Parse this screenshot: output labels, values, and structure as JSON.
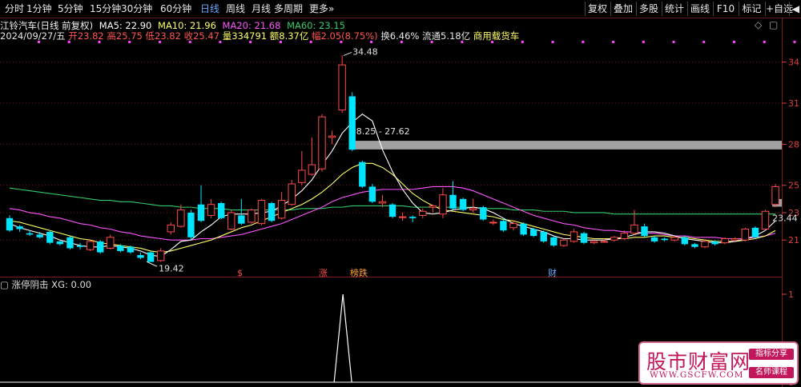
{
  "toolbar": {
    "periods": [
      "分时",
      "1分钟",
      "5分钟",
      "15分钟",
      "30分钟",
      "60分钟",
      "日线",
      "周线",
      "月线",
      "多周期",
      "更多"
    ],
    "active_period": "日线",
    "more_suffix": "»",
    "right_buttons": [
      "复权",
      "叠加",
      "多股",
      "统计",
      "画线",
      "F10",
      "标记",
      "+自选",
      "◀"
    ]
  },
  "info": {
    "stock_title": "江铃汽车(日线 前复权)",
    "ma5_label": "MA5: 22.90",
    "ma10_label": "MA10: 21.96",
    "ma20_label": "MA20: 21.68",
    "ma60_label": "MA60: 23.15",
    "date": "2024/09/27/五",
    "open": "开23.82",
    "high": "高25.75",
    "low": "低23.82",
    "close": "收25.47",
    "volume": "量334791",
    "amount": "额8.37亿",
    "change": "幅2.05(8.75%)",
    "turnover": "换6.46%",
    "float_cap": "流通5.18亿",
    "sector": "商用载货车",
    "corner_icons": [
      "◇",
      "▢"
    ]
  },
  "colors": {
    "up": "#ff4a4a",
    "down": "#00e5ff",
    "ma5": "#ffffff",
    "ma10": "#ffff66",
    "ma20": "#ff55ff",
    "ma60": "#33cc66",
    "grid": "#7a1c1c",
    "axis_text": "#e04040",
    "marker": "#ff40ff"
  },
  "chart_data": {
    "type": "candlestick",
    "ylim": [
      18.5,
      35.5
    ],
    "y_ticks": [
      21,
      23,
      25,
      28,
      31,
      34
    ],
    "candles": [
      {
        "o": 22.6,
        "c": 21.7,
        "h": 22.8,
        "l": 21.6
      },
      {
        "o": 22.0,
        "c": 21.8,
        "h": 22.1,
        "l": 21.6
      },
      {
        "o": 21.5,
        "c": 21.4,
        "h": 21.7,
        "l": 21.3
      },
      {
        "o": 21.4,
        "c": 21.2,
        "h": 21.6,
        "l": 21.1
      },
      {
        "o": 21.6,
        "c": 20.8,
        "h": 21.7,
        "l": 20.7
      },
      {
        "o": 20.9,
        "c": 20.7,
        "h": 21.0,
        "l": 20.6
      },
      {
        "o": 21.2,
        "c": 20.4,
        "h": 21.3,
        "l": 20.3
      },
      {
        "o": 20.6,
        "c": 20.5,
        "h": 20.8,
        "l": 20.3
      },
      {
        "o": 20.3,
        "c": 20.9,
        "h": 21.0,
        "l": 20.2
      },
      {
        "o": 20.9,
        "c": 20.1,
        "h": 21.0,
        "l": 20.0
      },
      {
        "o": 20.4,
        "c": 21.2,
        "h": 21.4,
        "l": 20.3
      },
      {
        "o": 20.6,
        "c": 20.2,
        "h": 20.7,
        "l": 20.1
      },
      {
        "o": 20.5,
        "c": 20.1,
        "h": 20.6,
        "l": 20.0
      },
      {
        "o": 19.9,
        "c": 19.7,
        "h": 20.1,
        "l": 19.6
      },
      {
        "o": 20.1,
        "c": 19.4,
        "h": 20.2,
        "l": 19.4
      },
      {
        "o": 19.5,
        "c": 20.2,
        "h": 20.4,
        "l": 19.4
      },
      {
        "o": 21.6,
        "c": 22.1,
        "h": 22.3,
        "l": 21.4
      },
      {
        "o": 22.0,
        "c": 23.2,
        "h": 23.6,
        "l": 21.9
      },
      {
        "o": 23.0,
        "c": 21.2,
        "h": 23.2,
        "l": 21.0
      },
      {
        "o": 23.6,
        "c": 22.4,
        "h": 25.0,
        "l": 22.3
      },
      {
        "o": 22.8,
        "c": 23.6,
        "h": 24.0,
        "l": 22.6
      },
      {
        "o": 23.7,
        "c": 22.6,
        "h": 23.8,
        "l": 22.5
      },
      {
        "o": 21.8,
        "c": 23.0,
        "h": 23.2,
        "l": 21.7
      },
      {
        "o": 22.8,
        "c": 22.2,
        "h": 24.0,
        "l": 22.1
      },
      {
        "o": 22.3,
        "c": 23.2,
        "h": 23.3,
        "l": 22.2
      },
      {
        "o": 22.2,
        "c": 23.9,
        "h": 24.0,
        "l": 22.1
      },
      {
        "o": 23.7,
        "c": 22.4,
        "h": 23.8,
        "l": 22.3
      },
      {
        "o": 22.6,
        "c": 23.9,
        "h": 24.5,
        "l": 22.5
      },
      {
        "o": 23.6,
        "c": 25.1,
        "h": 25.4,
        "l": 23.5
      },
      {
        "o": 25.2,
        "c": 26.1,
        "h": 27.5,
        "l": 25.0
      },
      {
        "o": 25.8,
        "c": 26.5,
        "h": 28.5,
        "l": 25.7
      },
      {
        "o": 26.2,
        "c": 30.0,
        "h": 30.2,
        "l": 26.0
      },
      {
        "o": 28.5,
        "c": 28.6,
        "h": 29.0,
        "l": 28.0
      },
      {
        "o": 30.5,
        "c": 33.8,
        "h": 34.5,
        "l": 30.3
      },
      {
        "o": 31.5,
        "c": 27.6,
        "h": 31.8,
        "l": 27.5
      },
      {
        "o": 26.7,
        "c": 24.9,
        "h": 26.8,
        "l": 24.8
      },
      {
        "o": 24.9,
        "c": 23.8,
        "h": 25.1,
        "l": 23.7
      },
      {
        "o": 23.7,
        "c": 23.8,
        "h": 24.3,
        "l": 23.4
      },
      {
        "o": 23.6,
        "c": 22.7,
        "h": 23.7,
        "l": 22.6
      },
      {
        "o": 22.7,
        "c": 22.7,
        "h": 23.0,
        "l": 22.4
      },
      {
        "o": 22.7,
        "c": 22.6,
        "h": 22.8,
        "l": 22.3
      },
      {
        "o": 22.8,
        "c": 23.1,
        "h": 23.3,
        "l": 22.6
      },
      {
        "o": 23.4,
        "c": 23.5,
        "h": 23.6,
        "l": 23.0
      },
      {
        "o": 22.9,
        "c": 24.3,
        "h": 24.8,
        "l": 22.6
      },
      {
        "o": 24.3,
        "c": 23.3,
        "h": 25.3,
        "l": 23.2
      },
      {
        "o": 24.0,
        "c": 23.2,
        "h": 24.1,
        "l": 23.1
      },
      {
        "o": 23.2,
        "c": 23.3,
        "h": 24.0,
        "l": 23.0
      },
      {
        "o": 23.4,
        "c": 22.5,
        "h": 23.5,
        "l": 22.4
      },
      {
        "o": 22.3,
        "c": 22.3,
        "h": 22.5,
        "l": 22.1
      },
      {
        "o": 22.4,
        "c": 21.7,
        "h": 22.6,
        "l": 21.6
      },
      {
        "o": 21.9,
        "c": 22.2,
        "h": 22.4,
        "l": 21.7
      },
      {
        "o": 22.2,
        "c": 21.4,
        "h": 22.3,
        "l": 21.3
      },
      {
        "o": 21.8,
        "c": 21.3,
        "h": 21.9,
        "l": 21.2
      },
      {
        "o": 21.6,
        "c": 20.9,
        "h": 21.7,
        "l": 20.8
      },
      {
        "o": 21.2,
        "c": 20.6,
        "h": 21.3,
        "l": 20.5
      },
      {
        "o": 20.6,
        "c": 21.0,
        "h": 21.1,
        "l": 20.5
      },
      {
        "o": 20.9,
        "c": 21.6,
        "h": 21.8,
        "l": 20.8
      },
      {
        "o": 21.5,
        "c": 20.8,
        "h": 21.6,
        "l": 20.7
      },
      {
        "o": 20.8,
        "c": 20.9,
        "h": 21.0,
        "l": 20.7
      },
      {
        "o": 20.9,
        "c": 20.9,
        "h": 21.1,
        "l": 20.8
      },
      {
        "o": 21.0,
        "c": 21.2,
        "h": 21.3,
        "l": 20.9
      },
      {
        "o": 21.1,
        "c": 21.5,
        "h": 21.7,
        "l": 21.0
      },
      {
        "o": 21.5,
        "c": 22.1,
        "h": 23.2,
        "l": 21.4
      },
      {
        "o": 22.0,
        "c": 21.3,
        "h": 22.2,
        "l": 21.2
      },
      {
        "o": 21.2,
        "c": 20.9,
        "h": 21.3,
        "l": 20.8
      },
      {
        "o": 21.1,
        "c": 21.0,
        "h": 21.2,
        "l": 20.9
      },
      {
        "o": 21.0,
        "c": 21.2,
        "h": 21.3,
        "l": 20.9
      },
      {
        "o": 21.2,
        "c": 20.7,
        "h": 21.3,
        "l": 20.6
      },
      {
        "o": 20.7,
        "c": 20.5,
        "h": 20.8,
        "l": 20.4
      },
      {
        "o": 20.5,
        "c": 20.9,
        "h": 21.0,
        "l": 20.4
      },
      {
        "o": 20.9,
        "c": 20.7,
        "h": 21.0,
        "l": 20.6
      },
      {
        "o": 20.8,
        "c": 21.1,
        "h": 21.2,
        "l": 20.7
      },
      {
        "o": 21.0,
        "c": 21.1,
        "h": 21.2,
        "l": 20.9
      },
      {
        "o": 21.0,
        "c": 21.8,
        "h": 21.9,
        "l": 20.9
      },
      {
        "o": 21.9,
        "c": 21.2,
        "h": 22.0,
        "l": 21.1
      },
      {
        "o": 21.8,
        "c": 23.1,
        "h": 23.2,
        "l": 21.7
      },
      {
        "o": 23.6,
        "c": 24.9,
        "h": 25.1,
        "l": 23.4
      }
    ],
    "ma5": [
      22.2,
      21.9,
      21.7,
      21.5,
      21.3,
      21.0,
      20.8,
      20.6,
      20.5,
      20.5,
      20.6,
      20.5,
      20.4,
      20.2,
      19.9,
      19.8,
      20.3,
      20.9,
      21.0,
      21.6,
      22.1,
      22.7,
      22.9,
      22.9,
      22.9,
      23.0,
      23.1,
      23.5,
      24.0,
      24.6,
      25.4,
      26.5,
      27.5,
      28.8,
      29.6,
      30.2,
      29.7,
      27.6,
      26.0,
      24.7,
      23.7,
      23.0,
      22.9,
      23.0,
      23.2,
      23.3,
      23.4,
      23.3,
      23.0,
      22.6,
      22.2,
      22.0,
      21.8,
      21.6,
      21.3,
      21.1,
      21.1,
      21.0,
      21.0,
      21.0,
      21.1,
      21.2,
      21.4,
      21.6,
      21.6,
      21.5,
      21.3,
      21.1,
      21.0,
      20.9,
      20.8,
      20.8,
      20.9,
      21.1,
      21.3,
      21.7,
      22.4
    ],
    "ma10": [
      22.4,
      22.3,
      22.1,
      21.9,
      21.7,
      21.5,
      21.3,
      21.1,
      21.0,
      20.8,
      20.7,
      20.6,
      20.5,
      20.4,
      20.2,
      20.1,
      20.2,
      20.4,
      20.6,
      20.8,
      21.0,
      21.3,
      21.6,
      21.9,
      22.1,
      22.4,
      22.7,
      23.0,
      23.3,
      23.6,
      24.0,
      24.5,
      25.1,
      25.8,
      26.3,
      26.6,
      26.6,
      26.3,
      25.8,
      25.1,
      24.4,
      23.9,
      23.5,
      23.2,
      23.1,
      23.0,
      22.9,
      22.8,
      22.7,
      22.5,
      22.4,
      22.2,
      22.0,
      21.8,
      21.6,
      21.4,
      21.3,
      21.2,
      21.1,
      21.1,
      21.1,
      21.1,
      21.2,
      21.2,
      21.3,
      21.3,
      21.2,
      21.2,
      21.1,
      21.0,
      20.9,
      20.9,
      20.9,
      21.0,
      21.1,
      21.3,
      21.7
    ],
    "ma20": [
      23.3,
      23.2,
      23.0,
      22.9,
      22.7,
      22.6,
      22.4,
      22.2,
      22.1,
      21.9,
      21.8,
      21.6,
      21.5,
      21.3,
      21.2,
      21.1,
      21.0,
      21.0,
      21.0,
      21.1,
      21.1,
      21.2,
      21.3,
      21.4,
      21.6,
      21.8,
      22.0,
      22.2,
      22.5,
      22.8,
      23.1,
      23.4,
      23.8,
      24.1,
      24.3,
      24.5,
      24.6,
      24.7,
      24.7,
      24.7,
      24.7,
      24.8,
      24.9,
      24.9,
      24.9,
      24.8,
      24.6,
      24.3,
      24.0,
      23.7,
      23.4,
      23.1,
      22.8,
      22.6,
      22.4,
      22.2,
      22.1,
      21.9,
      21.8,
      21.7,
      21.7,
      21.6,
      21.6,
      21.5,
      21.5,
      21.4,
      21.3,
      21.3,
      21.2,
      21.2,
      21.2,
      21.1,
      21.1,
      21.1,
      21.2,
      21.3,
      21.5
    ],
    "ma60": [
      24.8,
      24.7,
      24.6,
      24.5,
      24.4,
      24.3,
      24.2,
      24.1,
      24.0,
      23.9,
      23.9,
      23.8,
      23.8,
      23.7,
      23.6,
      23.5,
      23.5,
      23.4,
      23.4,
      23.3,
      23.3,
      23.3,
      23.2,
      23.2,
      23.2,
      23.2,
      23.2,
      23.2,
      23.2,
      23.3,
      23.3,
      23.3,
      23.4,
      23.4,
      23.5,
      23.5,
      23.5,
      23.5,
      23.5,
      23.5,
      23.4,
      23.4,
      23.4,
      23.4,
      23.4,
      23.4,
      23.4,
      23.3,
      23.3,
      23.3,
      23.2,
      23.2,
      23.2,
      23.1,
      23.1,
      23.1,
      23.0,
      23.0,
      23.0,
      23.0,
      22.9,
      22.9,
      22.9,
      22.9,
      22.9,
      22.9,
      22.9,
      22.9,
      22.9,
      22.9,
      22.9,
      22.9,
      22.9,
      22.9,
      22.9,
      22.9,
      22.9
    ],
    "annotations": {
      "high_label": "34.48",
      "low_label": "19.42",
      "zone1_label": "28.25 - 27.62",
      "zone2_label": "23.44 - 23.",
      "signals": [
        "$",
        "涨",
        "榜跌",
        "财"
      ]
    },
    "zones": [
      {
        "from_index": 34,
        "y_low": 27.62,
        "y_high": 28.25
      },
      {
        "from_index": 76,
        "y_low": 23.44,
        "y_high": 24.0
      }
    ],
    "subchart": {
      "title": "涨停阴击 XG: 0.00",
      "ylim": [
        0,
        1
      ],
      "y_ticks": [
        0,
        1
      ],
      "spike_index": 33,
      "spike_value": 1.0
    }
  },
  "watermark": {
    "name": "股市财富网",
    "url": "WWW.GSCFW.COM",
    "tag1": "指标分享",
    "tag2": "名师课程"
  }
}
